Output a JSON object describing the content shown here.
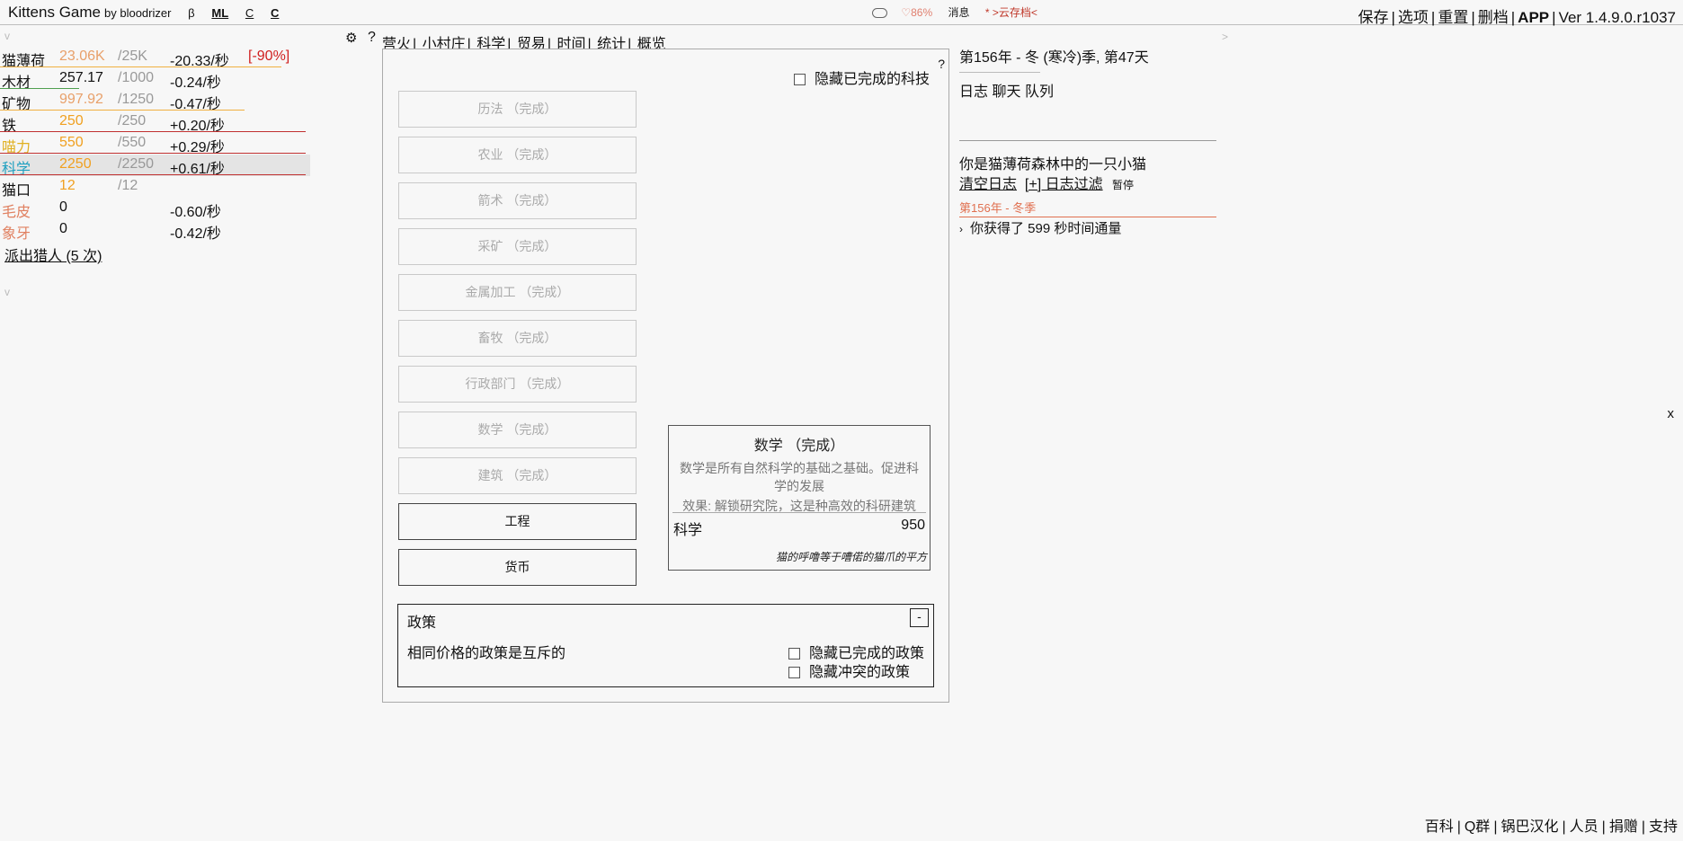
{
  "header": {
    "title": "Kittens Game",
    "by": "by bloodrizer",
    "flags": [
      "β",
      "ML",
      "C",
      "C"
    ],
    "status": {
      "happiness": "86%",
      "messages": "消息",
      "cloudsave": "* >云存档<"
    },
    "links": [
      "保存",
      "选项",
      "重置",
      "删档",
      "APP"
    ],
    "version": "Ver 1.4.9.0.r1037"
  },
  "resources": [
    {
      "name": "猫薄荷",
      "amount": "23.06K",
      "max": "/25K",
      "rate": "-20.33/秒",
      "warning": "[-90%]",
      "name_color": "#111111",
      "amount_color": "#e8a06a",
      "bar_color": "#f0b040",
      "bar_fill": 0.92
    },
    {
      "name": "木材",
      "amount": "257.17",
      "max": "/1000",
      "rate": "-0.24/秒",
      "warning": "",
      "name_color": "#111111",
      "amount_color": "#111111",
      "bar_color": "#50a050",
      "bar_fill": 0.26
    },
    {
      "name": "矿物",
      "amount": "997.92",
      "max": "/1250",
      "rate": "-0.47/秒",
      "warning": "",
      "name_color": "#111111",
      "amount_color": "#e8a06a",
      "bar_color": "#f0b040",
      "bar_fill": 0.8
    },
    {
      "name": "铁",
      "amount": "250",
      "max": "/250",
      "rate": "+0.20/秒",
      "warning": "",
      "name_color": "#111111",
      "amount_color": "#f0a020",
      "bar_color": "#c03030",
      "bar_fill": 1.0
    },
    {
      "name": "喵力",
      "amount": "550",
      "max": "/550",
      "rate": "+0.29/秒",
      "warning": "",
      "name_color": "#e0b020",
      "amount_color": "#f0a020",
      "bar_color": "#c03030",
      "bar_fill": 1.0
    },
    {
      "name": "科学",
      "amount": "2250",
      "max": "/2250",
      "rate": "+0.61/秒",
      "warning": "",
      "name_color": "#20a0c0",
      "amount_color": "#f0a020",
      "bar_color": "#c03030",
      "bar_fill": 1.0,
      "highlight": true
    },
    {
      "name": "猫口",
      "amount": "12",
      "max": "/12",
      "rate": "",
      "warning": "",
      "name_color": "#111111",
      "amount_color": "#f0a020",
      "bar_color": "",
      "bar_fill": 0
    },
    {
      "name": "毛皮",
      "amount": "0",
      "max": "",
      "rate": "-0.60/秒",
      "warning": "",
      "name_color": "#e08060",
      "amount_color": "#111111",
      "bar_color": "",
      "bar_fill": 0
    },
    {
      "name": "象牙",
      "amount": "0",
      "max": "",
      "rate": "-0.42/秒",
      "warning": "",
      "name_color": "#e08060",
      "amount_color": "#111111",
      "bar_color": "",
      "bar_fill": 0
    }
  ],
  "left": {
    "collapse": "v",
    "send_hunters": "派出猎人 (5 次)"
  },
  "tabs": {
    "gear": "⚙",
    "help": "?",
    "items": [
      "营火",
      "小村庄",
      "科学",
      "贸易",
      "时间",
      "统计",
      "概览"
    ]
  },
  "science": {
    "help": "?",
    "hide_completed": "隐藏已完成的科技",
    "techs": [
      {
        "label": "历法 （完成）",
        "done": true
      },
      {
        "label": "农业 （完成）",
        "done": true
      },
      {
        "label": "箭术 （完成）",
        "done": true
      },
      {
        "label": "采矿 （完成）",
        "done": true
      },
      {
        "label": "金属加工 （完成）",
        "done": true
      },
      {
        "label": "畜牧 （完成）",
        "done": true
      },
      {
        "label": "行政部门 （完成）",
        "done": true
      },
      {
        "label": "数学 （完成）",
        "done": true
      },
      {
        "label": "建筑 （完成）",
        "done": true
      },
      {
        "label": "工程",
        "done": false
      },
      {
        "label": "货币",
        "done": false
      }
    ],
    "tooltip": {
      "name": "数学 （完成）",
      "desc": "数学是所有自然科学的基础之基础。促进科学的发展",
      "effect": "效果: 解锁研究院，这是种高效的科研建筑",
      "price_resource": "科学",
      "price_amount": "950",
      "flavor": "猫的呼噜等于嘈偌的猫爪的平方"
    },
    "policies": {
      "title": "政策",
      "toggle": "-",
      "hint": "相同价格的政策是互斥的",
      "hide_completed": "隐藏已完成的政策",
      "hide_conflicting": "隐藏冲突的政策"
    }
  },
  "right": {
    "date": "第156年 - 冬 (寒冷)季, 第47天",
    "log_tabs": [
      "日志",
      "聊天",
      "队列"
    ],
    "intro": "你是猫薄荷森林中的一只小猫",
    "clear_log": "清空日志",
    "log_filter": "[+] 日志过滤",
    "pause": "暂停",
    "log_header": "第156年 - 冬季",
    "log_entry": "你获得了 599 秒时间通量",
    "collapse": ">",
    "close": "x"
  },
  "footer": {
    "links": [
      "百科",
      "Q群",
      "锅巴汉化",
      "人员",
      "捐赠",
      "支持"
    ]
  }
}
